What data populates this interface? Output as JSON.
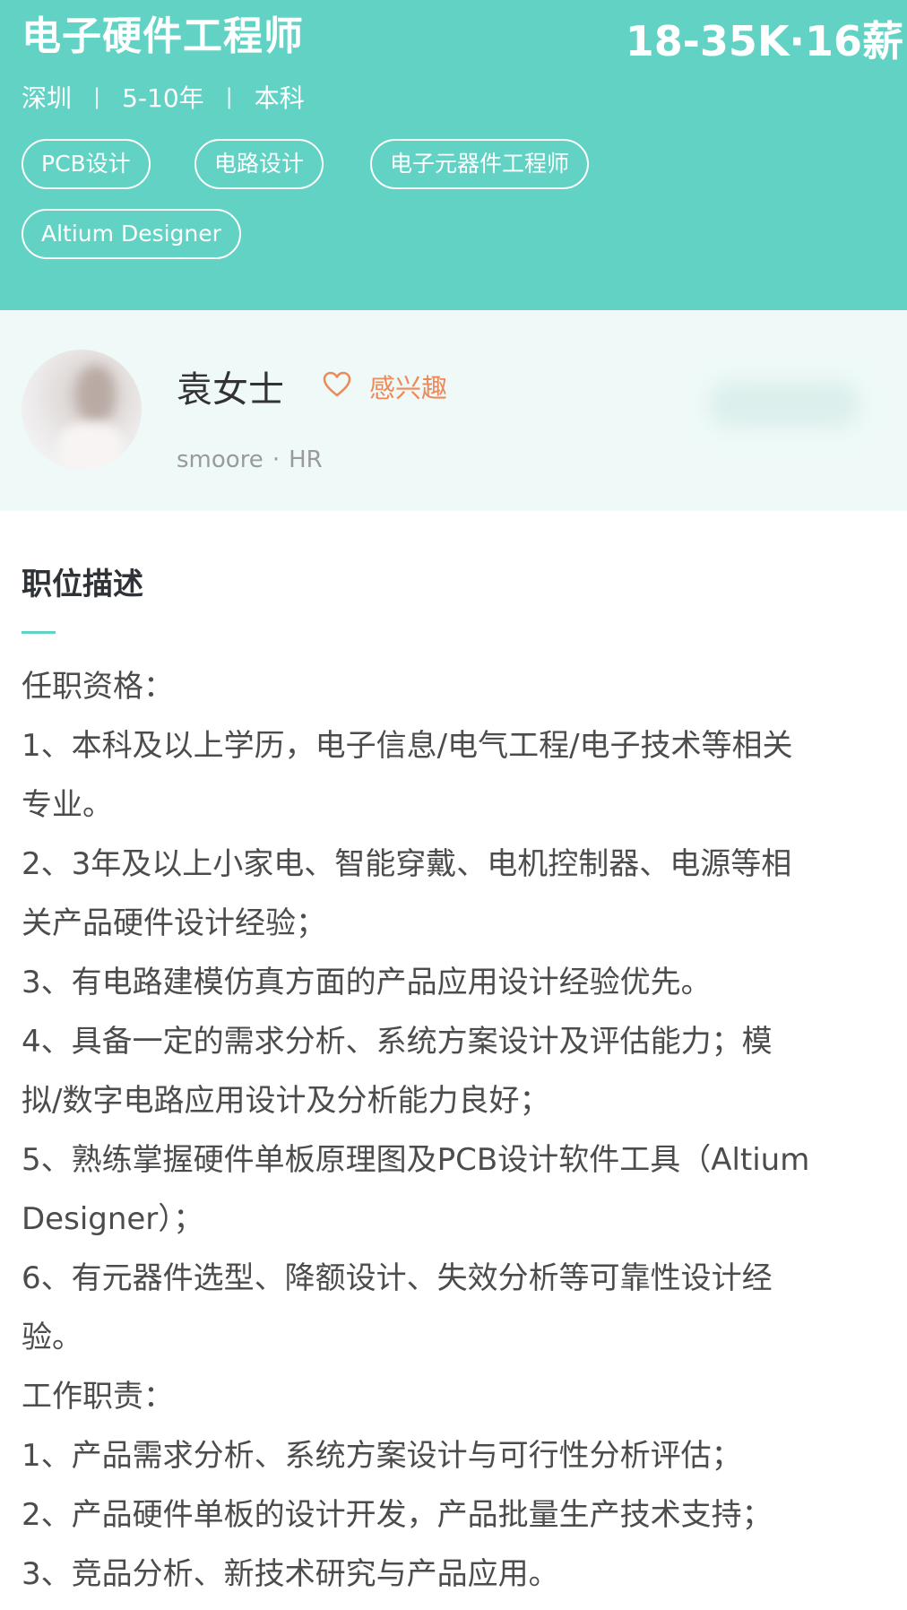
{
  "job": {
    "title": "电子硬件工程师",
    "salary": "18-35K·16薪",
    "city": "深圳",
    "experience": "5-10年",
    "education": "本科",
    "separator": "|",
    "tags": [
      "PCB设计",
      "电路设计",
      "电子元器件工程师",
      "Altium Designer"
    ]
  },
  "recruiter": {
    "name": "袁女士",
    "interest_label": "感兴趣",
    "username": "smoore",
    "dot": "·",
    "role": "HR",
    "icons": {
      "interest": "heart-outline-icon",
      "avatar": "recruiter-avatar-photo"
    }
  },
  "description": {
    "title": "职位描述",
    "lines": [
      "任职资格：",
      "1、本科及以上学历，电子信息/电气工程/电子技术等相关",
      "专业。",
      "2、3年及以上小家电、智能穿戴、电机控制器、电源等相",
      "关产品硬件设计经验；",
      "3、有电路建模仿真方面的产品应用设计经验优先。",
      "4、具备一定的需求分析、系统方案设计及评估能力；模",
      "拟/数字电路应用设计及分析能力良好；",
      "5、熟练掌握硬件单板原理图及PCB设计软件工具（Altium",
      "Designer）；",
      "6、有元器件选型、降额设计、失效分析等可靠性设计经",
      "验。",
      "工作职责：",
      "1、产品需求分析、系统方案设计与可行性分析评估；",
      "2、产品硬件单板的设计开发，产品批量生产技术支持；",
      "3、竞品分析、新技术研究与产品应用。"
    ]
  },
  "colors": {
    "header_bg": "#62d2c4",
    "recruiter_bg": "#effaf8",
    "accent_orange": "#ee8a5a",
    "body_text": "#4c4c4c"
  }
}
